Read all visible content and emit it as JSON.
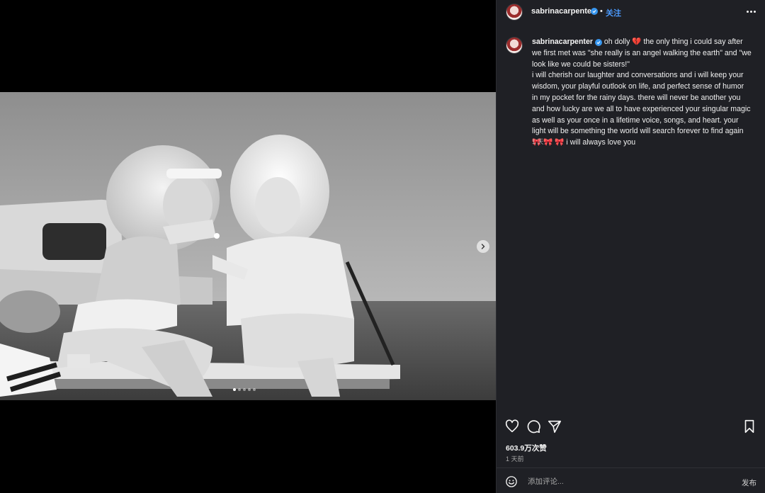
{
  "header": {
    "username": "sabrinacarpenter",
    "separator": "•",
    "follow_label": "关注"
  },
  "post": {
    "caption_user": "sabrinacarpenter",
    "caption_line1": " oh dolly ",
    "heart_emoji": "💔",
    "caption_body": " the only thing i could say after we first met was \"she really is an angel walking the earth\" and \"we look like we could be sisters!\"\ni will cherish our laughter and conversations and i will keep your wisdom, your playful outlook on life, and perfect sense of humor in my pocket for the rainy days. there will never be another you and how lucky are we all to have experienced your singular magic as well as your once in a lifetime voice, songs, and heart. your light will be something the world will search forever to find again ",
    "bow_emojis": "🎀 🎀 🎀",
    "caption_end": " i will always love you",
    "caption_age": "1 天",
    "likes": "603.9万次赞",
    "posted_time": "1 天前"
  },
  "carousel": {
    "current_index": 1,
    "total": 5
  },
  "comment": {
    "placeholder": "添加评论...",
    "post_label": "发布"
  },
  "icons": {
    "like": "heart-icon",
    "comment": "comment-icon",
    "share": "share-icon",
    "save": "bookmark-icon",
    "emoji": "emoji-icon",
    "next": "chevron-right-icon",
    "more": "more-icon",
    "verified": "verified-badge-icon"
  },
  "colors": {
    "panel_bg": "#1f2025",
    "link_blue": "#4c9bff",
    "verified_blue": "#3897f0"
  }
}
